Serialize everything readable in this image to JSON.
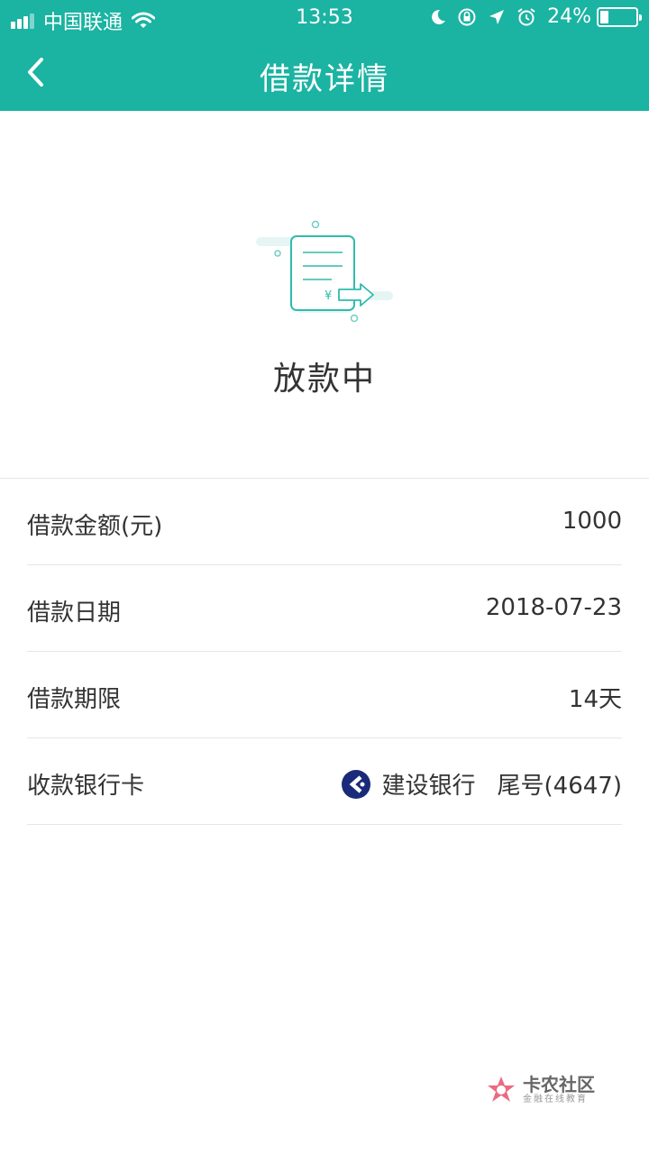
{
  "status_bar": {
    "carrier": "中国联通",
    "time": "13:53",
    "battery_text": "24%",
    "battery_level": 0.24,
    "icons": [
      "signal-icon",
      "wifi-icon",
      "moon-icon",
      "rotation-lock-icon",
      "location-icon",
      "alarm-icon",
      "battery-icon"
    ]
  },
  "nav": {
    "back_icon": "chevron-left-icon",
    "title": "借款详情"
  },
  "hero": {
    "icon": "document-transfer-icon",
    "status": "放款中",
    "accent_color": "#1bb3a2"
  },
  "details": {
    "rows": [
      {
        "label": "借款金额(元)",
        "value": "1000"
      },
      {
        "label": "借款日期",
        "value": "2018-07-23"
      },
      {
        "label": "借款期限",
        "value": "14天"
      }
    ],
    "bank": {
      "label": "收款银行卡",
      "logo": "ccb-bank-icon",
      "name": "建设银行",
      "tail": "尾号(4647)"
    }
  },
  "watermark": {
    "title": "卡农社区",
    "subtitle": "金融在线教育"
  },
  "colors": {
    "header": "#1bb3a2",
    "text": "#333333",
    "divider": "#e6e6e6",
    "bank_logo": "#1a2a7a"
  }
}
